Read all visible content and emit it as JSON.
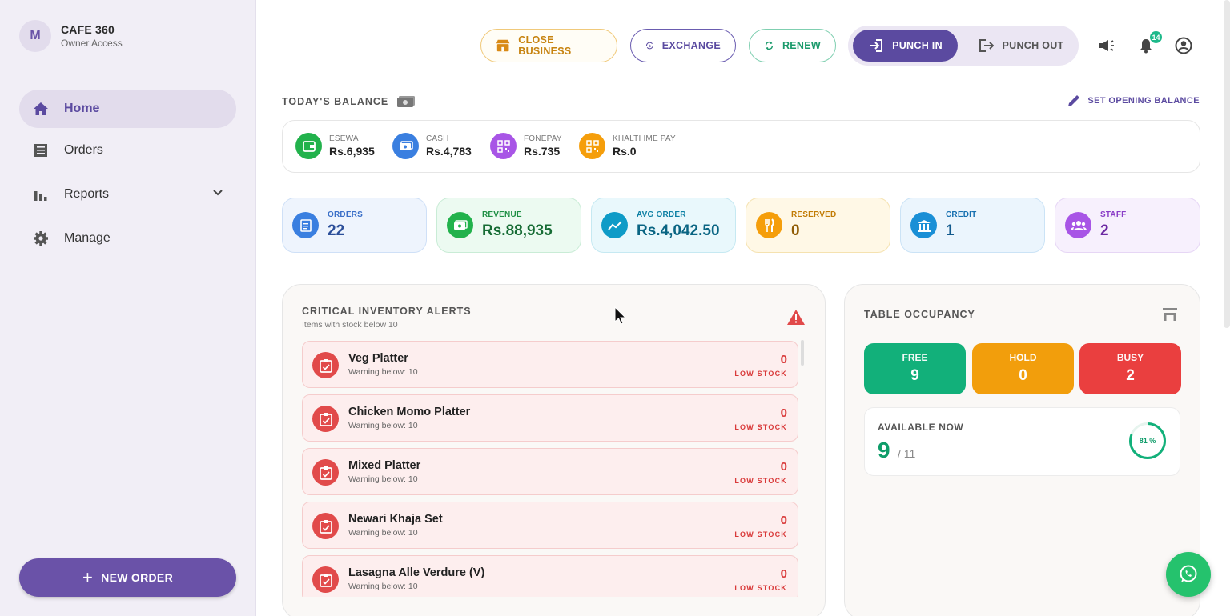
{
  "brand": {
    "initial": "M",
    "name": "CAFE 360",
    "role": "Owner Access"
  },
  "nav": {
    "home": "Home",
    "orders": "Orders",
    "reports": "Reports",
    "manage": "Manage"
  },
  "new_order_label": "NEW ORDER",
  "topbar": {
    "close_business": "CLOSE BUSINESS",
    "exchange": "EXCHANGE",
    "renew": "RENEW",
    "punch_in": "PUNCH IN",
    "punch_out": "PUNCH OUT",
    "notification_count": "14"
  },
  "balance": {
    "title": "TODAY'S BALANCE",
    "set_opening": "SET OPENING BALANCE",
    "items": [
      {
        "label": "ESEWA",
        "value": "Rs.6,935",
        "color": "#22b24c"
      },
      {
        "label": "CASH",
        "value": "Rs.4,783",
        "color": "#3a7fe0"
      },
      {
        "label": "FONEPAY",
        "value": "Rs.735",
        "color": "#a855e6"
      },
      {
        "label": "KHALTI IME PAY",
        "value": "Rs.0",
        "color": "#f59e0b"
      }
    ]
  },
  "stats": [
    {
      "label": "ORDERS",
      "value": "22",
      "color": "#3a7fe0"
    },
    {
      "label": "REVENUE",
      "value": "Rs.88,935",
      "color": "#22b24c"
    },
    {
      "label": "AVG ORDER",
      "value": "Rs.4,042.50",
      "color": "#0e9bc7"
    },
    {
      "label": "RESERVED",
      "value": "0",
      "color": "#f59e0b"
    },
    {
      "label": "CREDIT",
      "value": "1",
      "color": "#1a8fd6"
    },
    {
      "label": "STAFF",
      "value": "2",
      "color": "#a855e6"
    }
  ],
  "inventory": {
    "title": "CRITICAL INVENTORY ALERTS",
    "subtitle": "Items with stock below 10",
    "items": [
      {
        "name": "Veg Platter",
        "warning": "Warning below: 10",
        "qty": "0",
        "tag": "LOW STOCK"
      },
      {
        "name": "Chicken Momo Platter",
        "warning": "Warning below: 10",
        "qty": "0",
        "tag": "LOW STOCK"
      },
      {
        "name": "Mixed Platter",
        "warning": "Warning below: 10",
        "qty": "0",
        "tag": "LOW STOCK"
      },
      {
        "name": "Newari Khaja Set",
        "warning": "Warning below: 10",
        "qty": "0",
        "tag": "LOW STOCK"
      },
      {
        "name": "Lasagna Alle Verdure (V)",
        "warning": "Warning below: 10",
        "qty": "0",
        "tag": "LOW STOCK"
      }
    ]
  },
  "occupancy": {
    "title": "TABLE OCCUPANCY",
    "free_label": "FREE",
    "free_value": "9",
    "hold_label": "HOLD",
    "hold_value": "0",
    "busy_label": "BUSY",
    "busy_value": "2",
    "available_label": "AVAILABLE NOW",
    "available_value": "9",
    "available_total": "/ 11",
    "percent_text": "81 %",
    "percent": 81
  }
}
